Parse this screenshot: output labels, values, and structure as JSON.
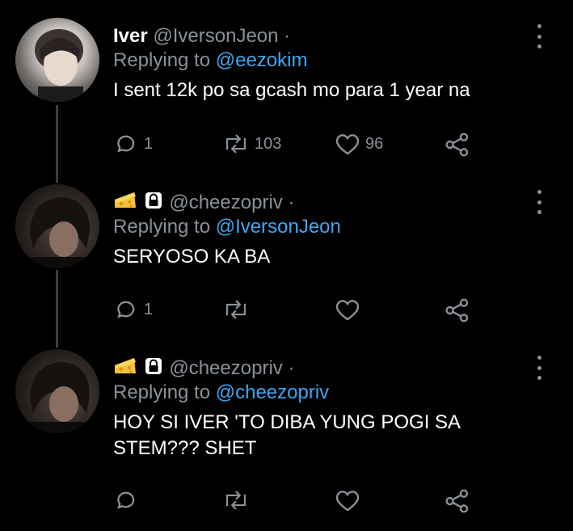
{
  "tweets": [
    {
      "display_name": "Iver",
      "handle": "@IversonJeon",
      "dot": "·",
      "replying_prefix": "Replying to",
      "replying_to": "@eezokim",
      "text": "I sent 12k po sa gcash mo para 1 year na",
      "replies": "1",
      "retweets": "103",
      "likes": "96"
    },
    {
      "display_name_icons": [
        "cheese-emoji",
        "lock-icon"
      ],
      "handle": "@cheezopriv",
      "dot": "·",
      "replying_prefix": "Replying to",
      "replying_to": "@IversonJeon",
      "text": "SERYOSO KA BA",
      "replies": "1",
      "retweets": "",
      "likes": ""
    },
    {
      "display_name_icons": [
        "cheese-emoji",
        "lock-icon"
      ],
      "handle": "@cheezopriv",
      "dot": "·",
      "replying_prefix": "Replying to",
      "replying_to": "@cheezopriv",
      "text": "HOY SI IVER 'TO DIBA YUNG POGI SA STEM??? SHET",
      "replies": "",
      "retweets": "",
      "likes": ""
    }
  ],
  "colors": {
    "background": "#000000",
    "muted": "#8a9198",
    "accent": "#3ea6ef",
    "thread_line": "#3a3d41"
  }
}
